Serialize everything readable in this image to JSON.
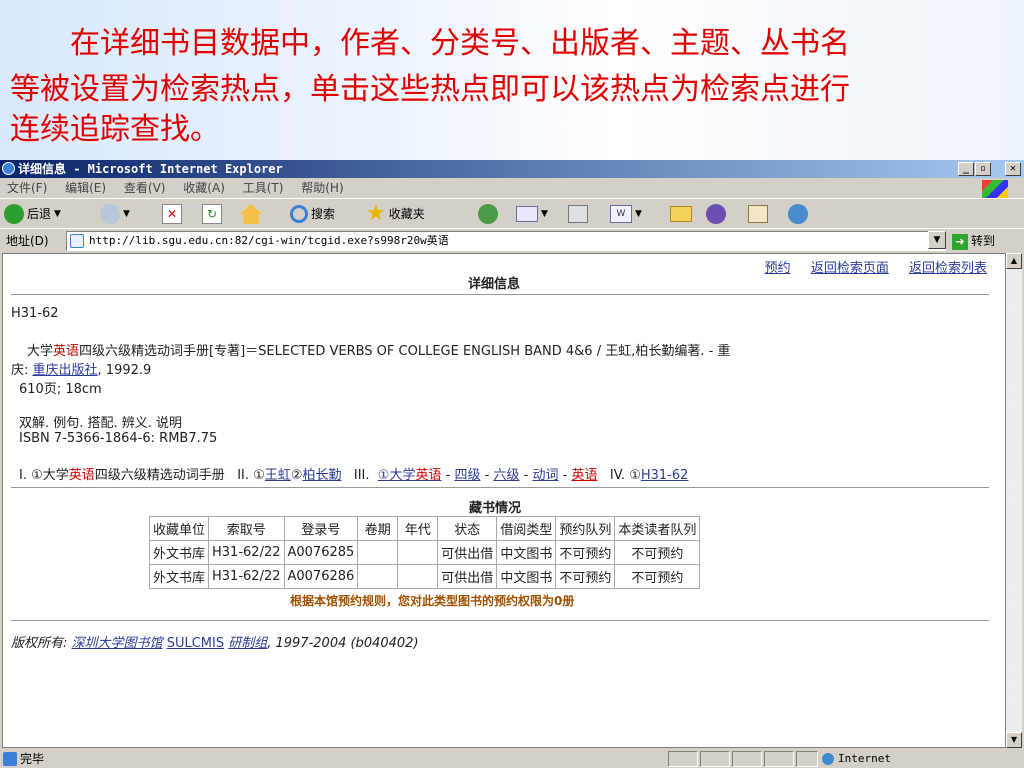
{
  "slide": {
    "line1": "　　在详细书目数据中，作者、分类号、出版者、主题、丛书名",
    "line2": "等被设置为检索热点，单击这些热点即可以该热点为检索点进行",
    "line3": "连续追踪查找。"
  },
  "window": {
    "title": "详细信息 - Microsoft Internet Explorer",
    "min": "_",
    "max": "▫",
    "close": "✕"
  },
  "menu": [
    "文件(F)",
    "编辑(E)",
    "查看(V)",
    "收藏(A)",
    "工具(T)",
    "帮助(H)"
  ],
  "toolbar": {
    "back": "后退",
    "search": "搜索",
    "favorites": "收藏夹"
  },
  "address": {
    "label": "地址(D)",
    "url": "http://lib.sgu.edu.cn:82/cgi-win/tcgid.exe?s998r20w英语",
    "go": "转到"
  },
  "page": {
    "links": {
      "reserve": "预约",
      "back_search": "返回检索页面",
      "back_list": "返回检索列表"
    },
    "heading": "详细信息",
    "callno": "H31-62",
    "record": {
      "p1a": "大学",
      "p1b": "英语",
      "p1c": "四级六级精选动词手册[专著]＝SELECTED VERBS OF COLLEGE ENGLISH BAND 4&6 / 王虹,柏长勤编著. - 重",
      "p2a": "庆: ",
      "publisher": "重庆出版社",
      "p2b": ", 1992.9",
      "pages": "610页; 18cm",
      "notes": "双解. 例句. 搭配. 辨义. 说明",
      "isbn": "ISBN 7-5366-1864-6: RMB7.75"
    },
    "tracing": {
      "t1": "I. ①大学",
      "t1red": "英语",
      "t1b": "四级六级精选动词手册",
      "t2": "II. ①",
      "author1": "王虹",
      "sep2": "②",
      "author2": "柏长勤",
      "t3": "III.",
      "s1a": "①大学",
      "s1b": "英语",
      "dash": "-",
      "s2": "四级",
      "s3": "六级",
      "s4": "动词",
      "s5": "英语",
      "t4": "IV. ①",
      "cls": "H31-62"
    },
    "holdings_title": "藏书情况",
    "holdings": {
      "headers": [
        "收藏单位",
        "索取号",
        "登录号",
        "卷期",
        "年代",
        "状态",
        "借阅类型",
        "预约队列",
        "本类读者队列"
      ],
      "rows": [
        [
          "外文书库",
          "H31-62/22",
          "A0076285",
          "",
          "",
          "可供出借",
          "中文图书",
          "不可预约",
          "不可预约"
        ],
        [
          "外文书库",
          "H31-62/22",
          "A0076286",
          "",
          "",
          "可供出借",
          "中文图书",
          "不可预约",
          "不可预约"
        ]
      ]
    },
    "notice": "根据本馆预约规则，您对此类型图书的预约权限为0册",
    "copyright": {
      "label": "版权所有:",
      "org": "深圳大学图书馆",
      "sys": "SULCMIS",
      "group": "研制组",
      "tail": ", 1997-2004 (b040402)"
    }
  },
  "status": {
    "text": "完毕",
    "zone": "Internet"
  }
}
